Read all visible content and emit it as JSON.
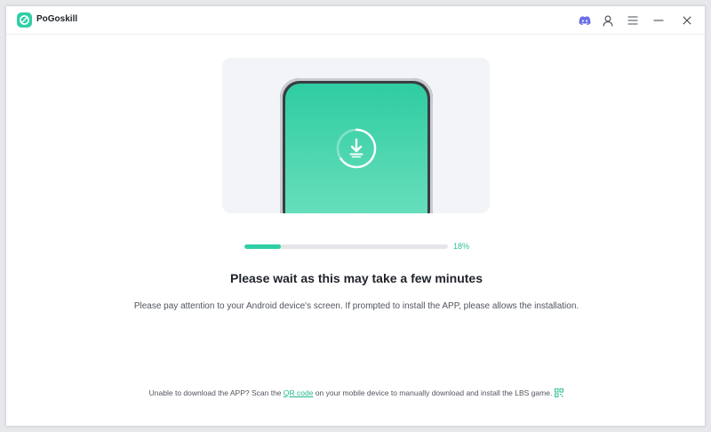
{
  "app": {
    "title": "PoGoskill",
    "accent_color": "#2fcfa5"
  },
  "titlebar": {
    "icons": [
      "discord-icon",
      "user-icon",
      "menu-icon",
      "minimize-icon",
      "close-icon"
    ]
  },
  "progress": {
    "percent_label": "18%",
    "value": 0.18
  },
  "main": {
    "headline": "Please wait as this may take a few minutes",
    "instruction": "Please pay attention to your Android device's screen. If prompted to install the APP, please allows the installation."
  },
  "footer": {
    "text_before": "Unable to download the APP? Scan the ",
    "link_label": "QR code",
    "text_after": " on your mobile device to manually download and install the LBS game."
  }
}
